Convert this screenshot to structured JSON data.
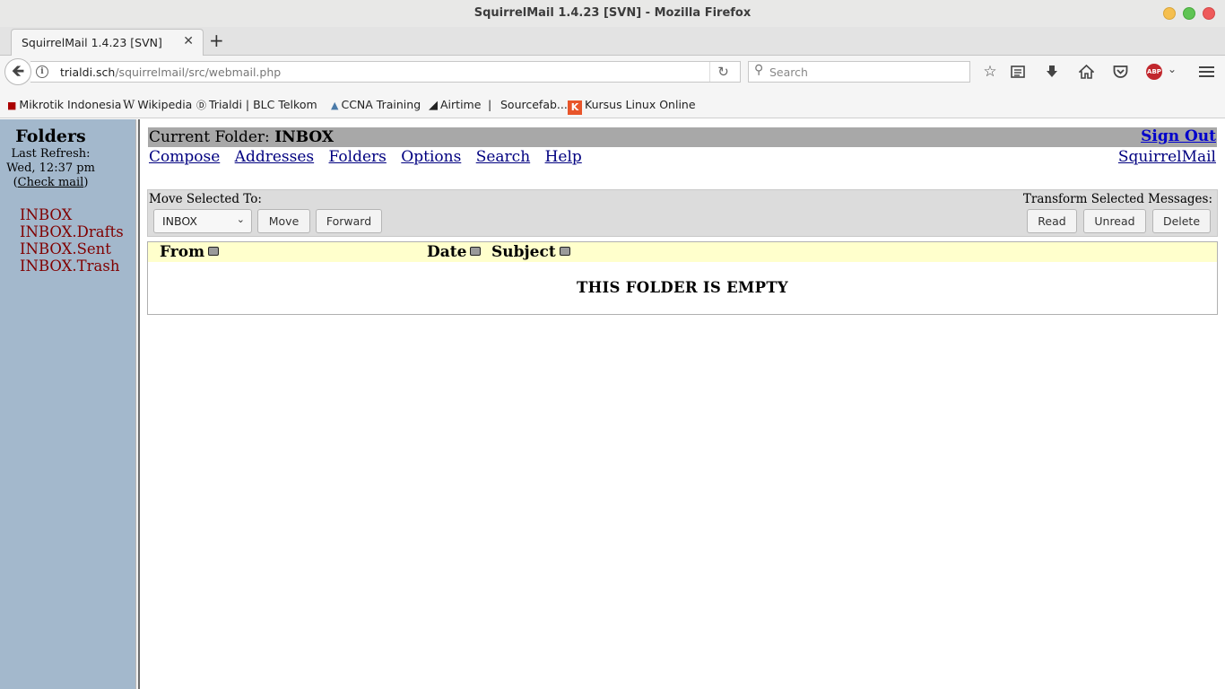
{
  "window": {
    "title": "SquirrelMail 1.4.23 [SVN] - Mozilla Firefox"
  },
  "tab": {
    "title": "SquirrelMail 1.4.23 [SVN]",
    "close": "✕",
    "new_tab": "+"
  },
  "navbar": {
    "url_host": "trialdi.sch",
    "url_path": "/squirrelmail/src/webmail.php",
    "search_placeholder": "Search"
  },
  "bookmarks": [
    {
      "label": "Mikrotik Indonesia",
      "icon": "mikrotik-icon"
    },
    {
      "label": "Wikipedia",
      "icon": "wikipedia-icon"
    },
    {
      "label": "Trialdi | BLC Telkom",
      "icon": "trialdi-icon"
    },
    {
      "label": "CCNA Training",
      "icon": "ccna-icon"
    },
    {
      "label": "Airtime",
      "icon": "airtime-icon"
    },
    {
      "label": "|",
      "icon": ""
    },
    {
      "label": "Sourcefab...",
      "icon": "sourcefabric-icon"
    },
    {
      "label": "Kursus Linux Online",
      "icon": "kursus-icon"
    }
  ],
  "sidebar": {
    "heading": "Folders",
    "refresh_label": "Last Refresh:",
    "refresh_time": "Wed, 12:37 pm",
    "check_mail_open": "(",
    "check_mail": "Check mail",
    "check_mail_close": ")",
    "folders": [
      "INBOX",
      "INBOX.Drafts",
      "INBOX.Sent",
      "INBOX.Trash"
    ]
  },
  "main": {
    "current_folder_label": "Current Folder:",
    "current_folder": "INBOX",
    "sign_out": "Sign Out",
    "nav": [
      "Compose",
      "Addresses",
      "Folders",
      "Options",
      "Search",
      "Help"
    ],
    "home_link": "SquirrelMail",
    "move_label": "Move Selected To:",
    "move_target": "INBOX",
    "move_button": "Move",
    "forward_button": "Forward",
    "transform_label": "Transform Selected Messages:",
    "read_button": "Read",
    "unread_button": "Unread",
    "delete_button": "Delete",
    "columns": [
      "From",
      "Date",
      "Subject"
    ],
    "empty_message": "THIS FOLDER IS EMPTY"
  }
}
